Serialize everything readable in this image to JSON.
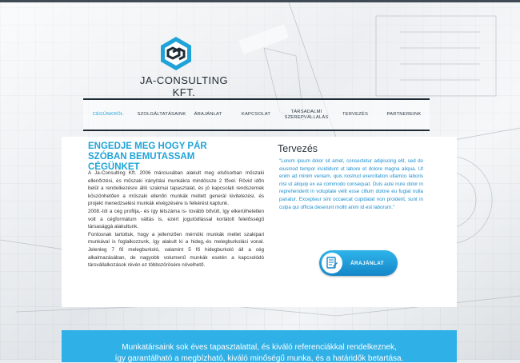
{
  "brand": {
    "name": "JA-CONSULTING KFT."
  },
  "nav": {
    "items": [
      {
        "label": "CÉGÜNKRŐL",
        "active": true
      },
      {
        "label": "SZOLGÁLTATÁSAINK",
        "active": false
      },
      {
        "label": "ÁRAJÁNLAT",
        "active": false
      },
      {
        "label": "KAPCSOLAT",
        "active": false
      },
      {
        "label": "TÁRSADALMI SZEREPVÁLLALÁS",
        "active": false
      },
      {
        "label": "TERVEZÉS",
        "active": false
      },
      {
        "label": "PARTNEREINK",
        "active": false
      }
    ]
  },
  "main": {
    "heading": "ENGEDJE MEG HOGY PÁR SZÓBAN BEMUTASSAM CÉGÜNKET",
    "paragraphs": [
      "A Ja-Consulting Kft. 2006 márciusában alakult meg elsősorban műszaki ellenőrzési, és műszaki irányítási munkákra mindössze 2 fővel. Rövid időn belül a rendelkezésre álló szakmai tapasztalat, és jó kapcsolati rendszernek köszönhetően a műszaki ellenőri munkák mellett generál kivitelezési, és projekt menedzselési munkák elvégzésére is felkérést kaptunk.",
      "2008.-tól a cég profilja,- és így létszáma is- tovább bővült, így elkerülhetetlen volt a cégformátum váltás is, ezért jogutódlással korlátolt felelősségű társasággá alakultunk.",
      "Fontosnak tartottuk, hogy a jellemzően mérnöki munkák mellet szakipari munkával is foglalkozzunk, így alakult ki a hideg,-és melegburkolási vonal. Jelenleg 7 fő melegburkoló, valamint 5 fő hidegburkoló áll a cég alkalmazásában, de nagyobb volumenű munkák esetén a kapcsolódó társvállalkozások révén ez többszörösére növelhető."
    ]
  },
  "aside": {
    "title": "Tervezés",
    "quote": "\"Lorem ipsum dolor sit amet, consectetur adipiscing elit, sed do eiusmod tempor incididunt ut labore et dolore magna aliqua. Ut enim ad minim veniam, quis nostrud exercitation ullamco laboris nisi ut aliquip ex ea commodo consequat. Duis aute irure dolor in reprehenderit in voluptate velit esse cillum dolore eu fugiat nulla pariatur. Excepteur sint occaecat cupidatat non proident, sunt in culpa qui officia deserunt mollit anim id est laborum.\"",
    "cta_label": "ÁRAJÁNLAT",
    "cta_icon": "document-edit-icon"
  },
  "banner": {
    "line1": "Munkatársaink sok éves tapasztalattal, és kiváló referenciákkal rendelkeznek,",
    "line2": "így garantálható a megbízható, kiváló minőségű munka, és a határidők betartása."
  },
  "colors": {
    "accent": "#1fa3d8",
    "banner": "#2fb0e6",
    "nav_border": "#1e2b35"
  }
}
